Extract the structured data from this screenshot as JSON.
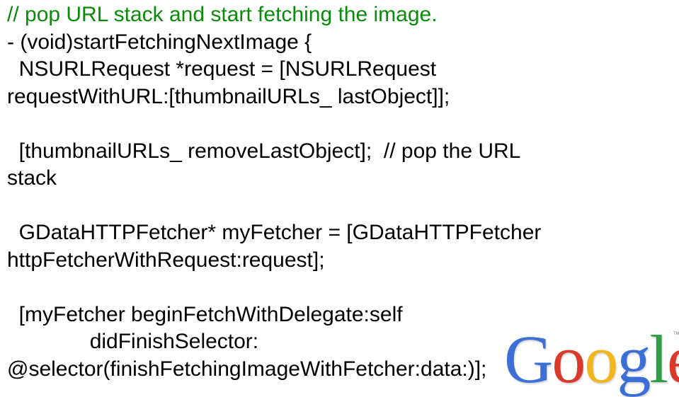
{
  "code": {
    "lines": [
      "// pop URL stack and start fetching the image.",
      "- (void)startFetchingNextImage {",
      "  NSURLRequest *request = [NSURLRequest",
      "requestWithURL:[thumbnailURLs_ lastObject]];",
      "",
      "  [thumbnailURLs_ removeLastObject];  // pop the URL",
      "stack",
      "",
      "  GDataHTTPFetcher* myFetcher = [GDataHTTPFetcher",
      "httpFetcherWithRequest:request];",
      "",
      "  [myFetcher beginFetchWithDelegate:self",
      "              didFinishSelector:",
      "@selector(finishFetchingImageWithFetcher:data:)];"
    ],
    "comment_color": "#0a8a0a",
    "text_color": "#000000"
  },
  "logo": {
    "letters": [
      "G",
      "o",
      "o",
      "g",
      "l",
      "e"
    ],
    "colors": [
      "#3b6fd6",
      "#d93a2b",
      "#f2b51c",
      "#3b6fd6",
      "#2f9e44",
      "#d93a2b"
    ],
    "trademark": "TM"
  }
}
